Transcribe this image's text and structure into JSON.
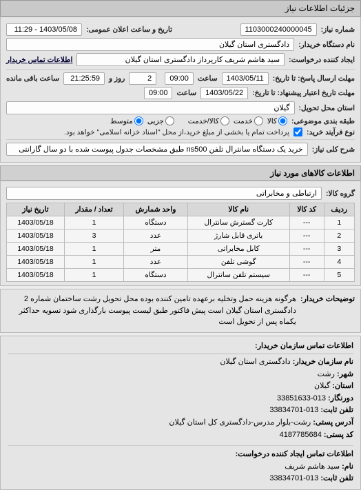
{
  "header": {
    "title": "جزئیات اطلاعات نیاز"
  },
  "fields": {
    "number_label": "شماره نیاز:",
    "number": "1103000240000045",
    "announce_label": "تاریخ و ساعت اعلان عمومی:",
    "announce": "1403/05/08 - 11:29",
    "buyer_org_label": "نام دستگاه خریدار:",
    "buyer_org": "دادگستری استان گیلان",
    "requester_label": "ایجاد کننده درخواست:",
    "requester": "سید هاشم شریف کارپرداز دادگستری استان گیلان",
    "contact_link": "اطلاعات تماس خریدار",
    "deadline_reply_label": "مهلت ارسال پاسخ: تا تاریخ:",
    "deadline_reply_date": "1403/05/11",
    "time_label": "ساعت",
    "deadline_reply_time": "09:00",
    "days_left_prefix": "",
    "days_left": "2",
    "days_left_suffix": "روز و",
    "remaining_time": "21:25:59",
    "remaining_suffix": "ساعت باقی مانده",
    "validity_label": "مهلت تاریخ اعتبار پیشنهاد: تا تاریخ:",
    "validity_date": "1403/05/22",
    "validity_time": "09:00",
    "province_label": "استان محل تحویل:",
    "province": "گیلان",
    "cod_label": "نوع فرآیند خرید:",
    "cod_note": "پرداخت تمام یا بخشی از مبلغ خرید،از محل \"اسناد خزانه اسلامی\" خواهد بود.",
    "subject_label": "شرح کلی نیاز:",
    "subject": "خرید یک دستگاه سانترال تلفن ns500 طبق مشخصات جدول پیوست شده با دو سال گارانتی",
    "budget_label": "طبقه بندی موضوعی:"
  },
  "budget_options": {
    "goods": "کالا",
    "service": "خدمت",
    "partial_goods": "کالا/خدمت",
    "partial": "جزیی",
    "medium": "متوسط"
  },
  "items_header": "اطلاعات کالاهای مورد نیاز",
  "group_label": "گروه کالا:",
  "group_value": "ارتباطی و مخابراتی",
  "columns": {
    "row": "ردیف",
    "code": "کد کالا",
    "name": "نام کالا",
    "unit": "واحد شمارش",
    "qty": "تعداد / مقدار",
    "need_date": "تاریخ نیاز"
  },
  "items": [
    {
      "row": "1",
      "code": "---",
      "name": "کارت گسترش سانترال",
      "unit": "دستگاه",
      "qty": "1",
      "need_date": "1403/05/18"
    },
    {
      "row": "2",
      "code": "---",
      "name": "باتری قابل شارژ",
      "unit": "عدد",
      "qty": "3",
      "need_date": "1403/05/18"
    },
    {
      "row": "3",
      "code": "---",
      "name": "کابل مخابراتی",
      "unit": "متر",
      "qty": "1",
      "need_date": "1403/05/18"
    },
    {
      "row": "4",
      "code": "---",
      "name": "گوشی تلفن",
      "unit": "عدد",
      "qty": "1",
      "need_date": "1403/05/18"
    },
    {
      "row": "5",
      "code": "---",
      "name": "سیستم تلفن سانترال",
      "unit": "دستگاه",
      "qty": "1",
      "need_date": "1403/05/18"
    }
  ],
  "buyer_desc_label": "توضیحات خریدار:",
  "buyer_desc": "هرگونه هزینه حمل وتخلیه برعهده تامین کننده بوده محل تحویل رشت ساختمان شماره 2 دادگستری استان گیلان است پیش فاکتور طبق لیست پیوست بارگذاری شود تسویه حداکثر یکماه پس از تحویل است",
  "contact": {
    "header": "اطلاعات تماس سازمان خریدار:",
    "org_label": "نام سازمان خریدار:",
    "org": "دادگستری استان گیلان",
    "city_label": "شهر:",
    "city": "رشت",
    "province_label": "استان:",
    "province": "گیلان",
    "fax_label": "دورنگار:",
    "fax": "013-33851633",
    "phone_label": "تلفن ثابت:",
    "phone": "013-33834701",
    "postal_addr_label": "آدرس پستی:",
    "postal_addr": "رشت-بلوار مدرس-دادگستری کل استان گیلان",
    "postal_code_label": "کد پستی:",
    "postal_code": "4187785684",
    "requester_caption": "اطلاعات تماس ایجاد کننده درخواست:",
    "name_label": "نام:",
    "name": "سید هاشم شریف",
    "contact_phone_label": "تلفن ثابت:",
    "contact_phone": "013-33834701"
  }
}
